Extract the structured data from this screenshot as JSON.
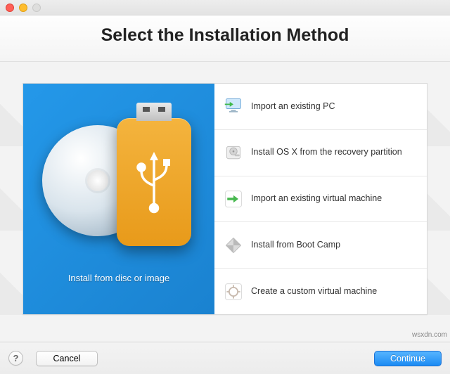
{
  "header": {
    "title": "Select the Installation Method"
  },
  "left_panel": {
    "label": "Install from disc or image"
  },
  "options": [
    {
      "label": "Import an existing PC"
    },
    {
      "label": "Install OS X from the recovery partition"
    },
    {
      "label": "Import an existing virtual machine"
    },
    {
      "label": "Install from Boot Camp"
    },
    {
      "label": "Create a custom virtual machine"
    }
  ],
  "footer": {
    "help": "?",
    "cancel": "Cancel",
    "continue": "Continue"
  },
  "watermark": "wsxdn.com"
}
